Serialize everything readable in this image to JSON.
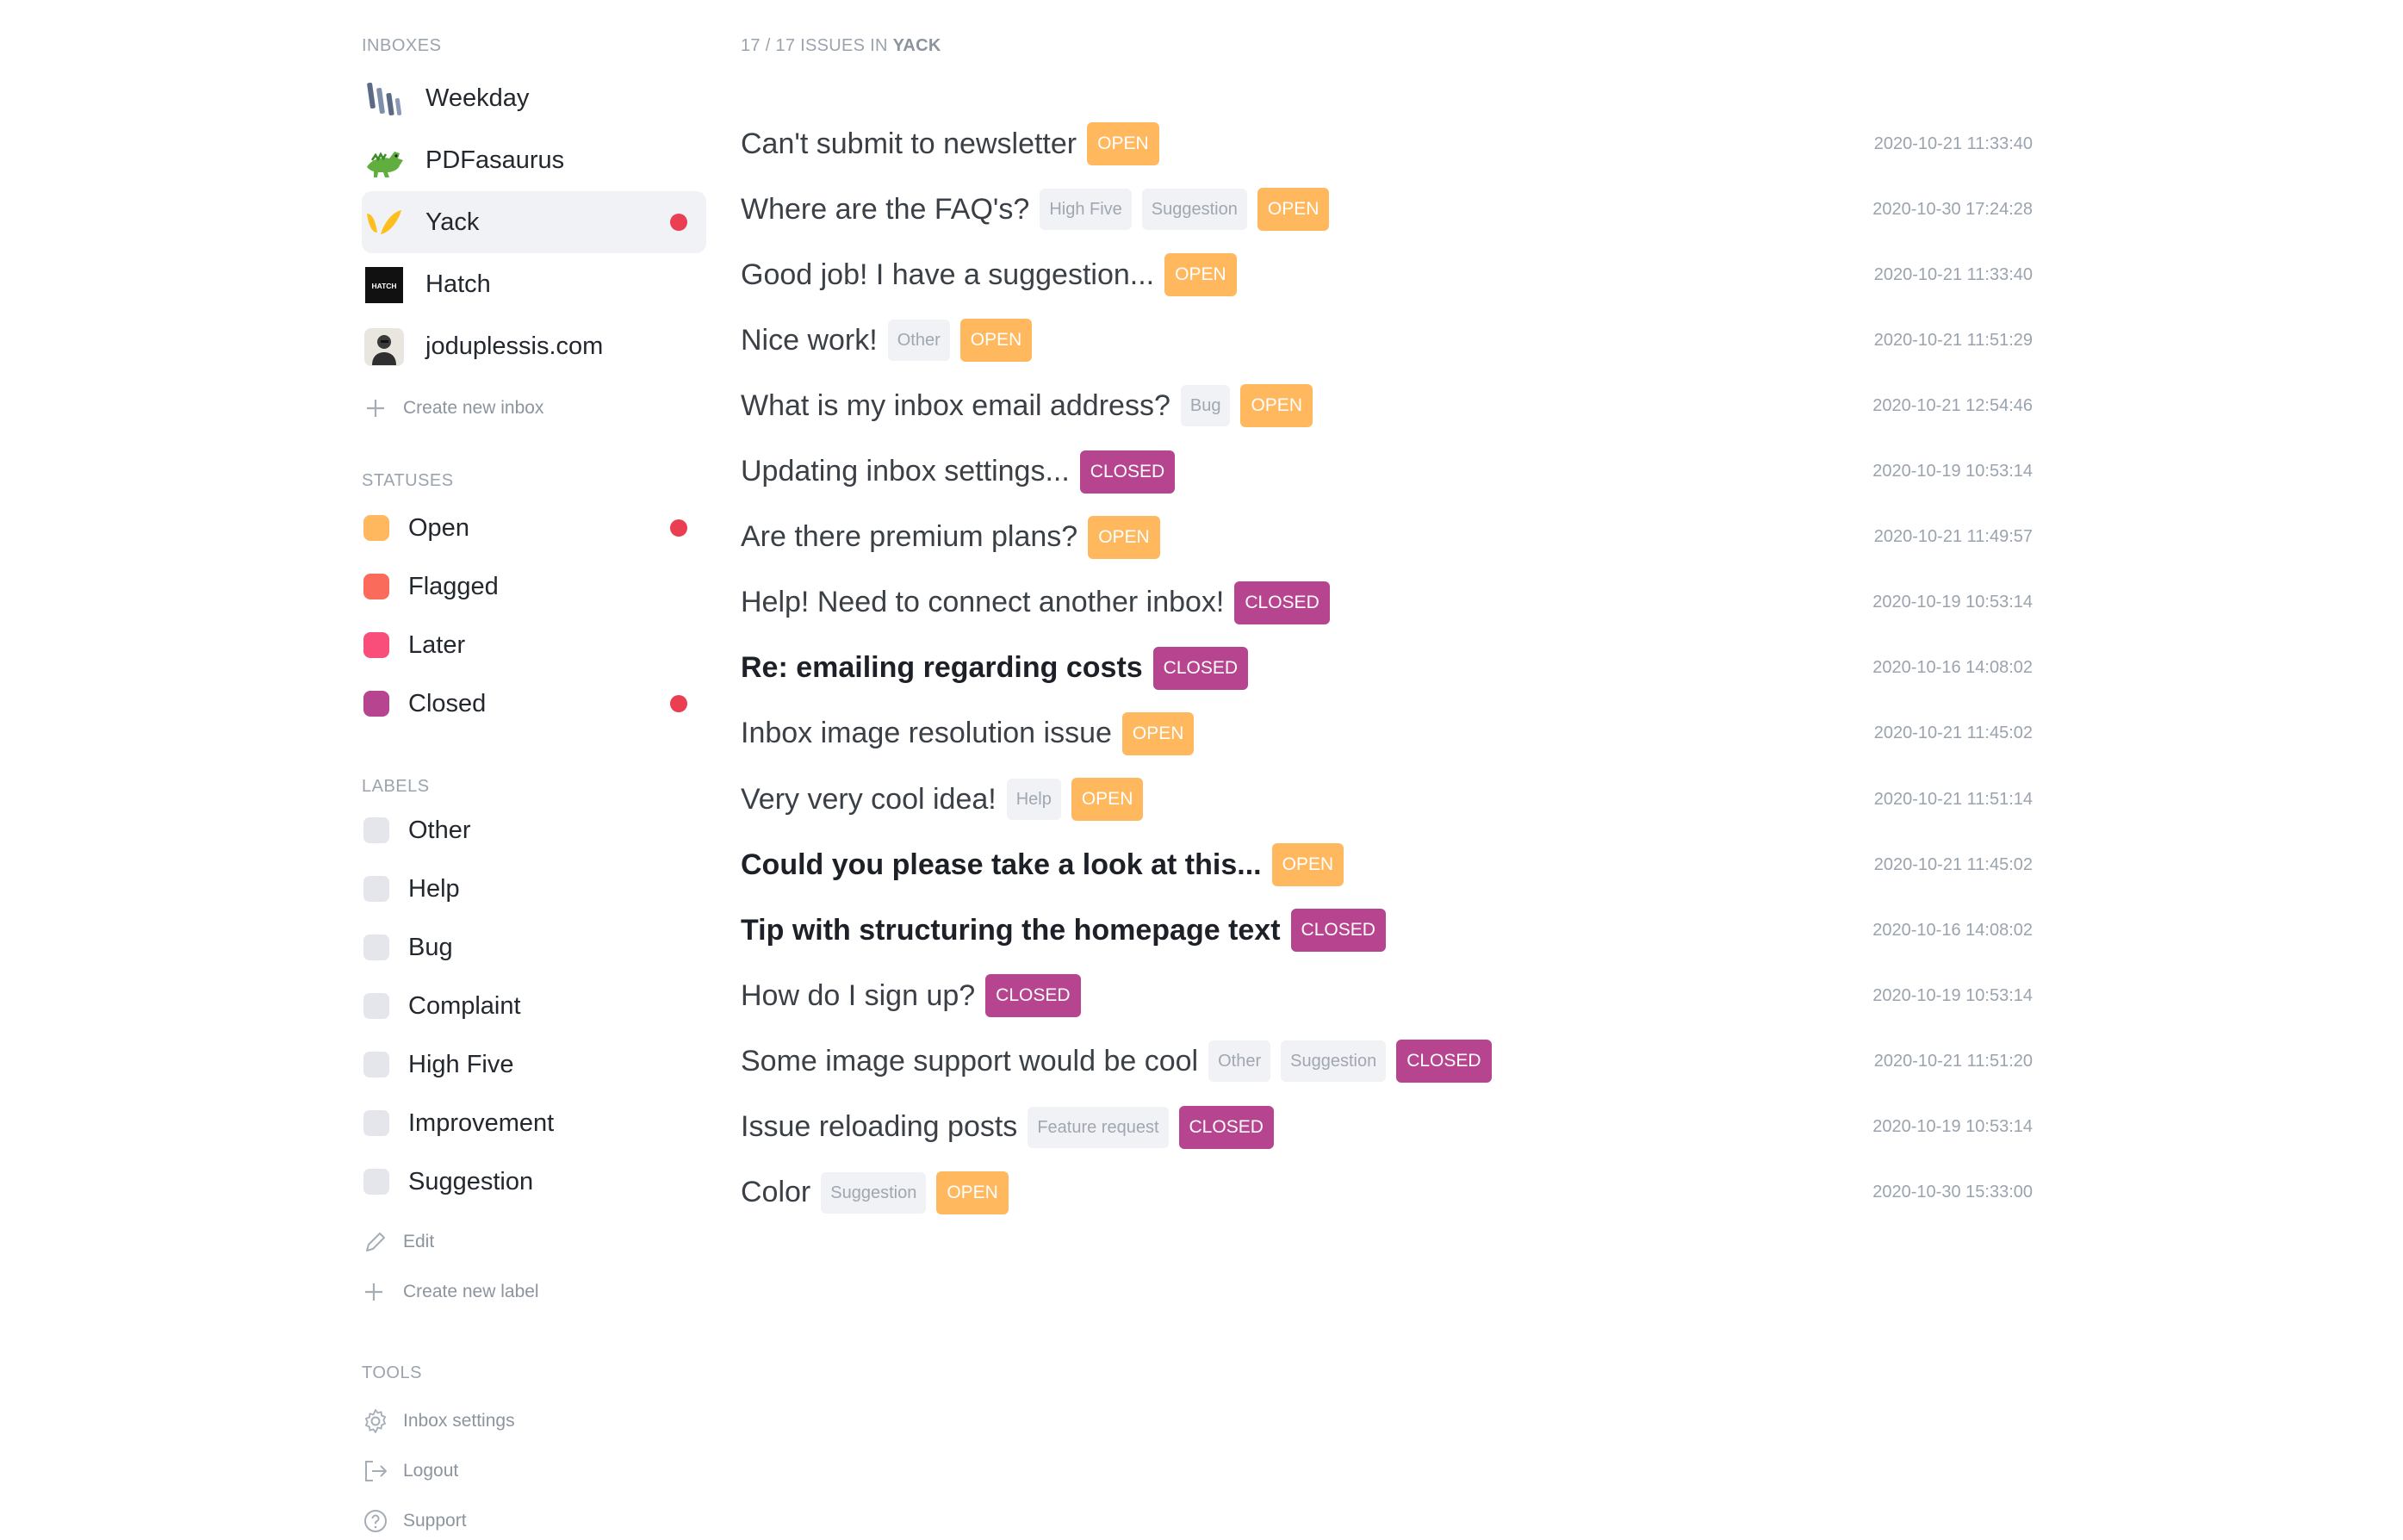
{
  "sidebar": {
    "inboxes_heading": "INBOXES",
    "inboxes": [
      {
        "name": "Weekday",
        "icon": "weekday-logo-icon",
        "active": false,
        "unread": false
      },
      {
        "name": "PDFasaurus",
        "icon": "pdfasaurus-dinosaur-icon",
        "active": false,
        "unread": false
      },
      {
        "name": "Yack",
        "icon": "yack-logo-icon",
        "active": true,
        "unread": true
      },
      {
        "name": "Hatch",
        "icon": "hatch-logo-icon",
        "logo_text": "HATCH",
        "active": false,
        "unread": false
      },
      {
        "name": "joduplessis.com",
        "icon": "avatar-icon",
        "active": false,
        "unread": false
      }
    ],
    "create_inbox": "Create new inbox",
    "statuses_heading": "STATUSES",
    "statuses": [
      {
        "name": "Open",
        "color": "#ffb85e",
        "unread": true
      },
      {
        "name": "Flagged",
        "color": "#fb6b5b",
        "unread": false
      },
      {
        "name": "Later",
        "color": "#f94e79",
        "unread": false
      },
      {
        "name": "Closed",
        "color": "#b6448f",
        "unread": true
      }
    ],
    "labels_heading": "LABELS",
    "labels": [
      "Other",
      "Help",
      "Bug",
      "Complaint",
      "High Five",
      "Improvement",
      "Suggestion"
    ],
    "edit": "Edit",
    "create_label": "Create new label",
    "tools_heading": "TOOLS",
    "tools": [
      {
        "name": "Inbox settings",
        "icon": "gear-icon"
      },
      {
        "name": "Logout",
        "icon": "logout-icon"
      },
      {
        "name": "Support",
        "icon": "help-circle-icon"
      }
    ]
  },
  "main": {
    "count_prefix": "17 / 17 ISSUES IN",
    "count_inbox": "YACK",
    "issues": [
      {
        "title": "Can't submit to newsletter",
        "tags": [],
        "status": "OPEN",
        "time": "2020-10-21 11:33:40",
        "unread": false
      },
      {
        "title": "Where are the FAQ's?",
        "tags": [
          "High Five",
          "Suggestion"
        ],
        "status": "OPEN",
        "time": "2020-10-30 17:24:28",
        "unread": false
      },
      {
        "title": "Good job! I have a suggestion...",
        "tags": [],
        "status": "OPEN",
        "time": "2020-10-21 11:33:40",
        "unread": false
      },
      {
        "title": "Nice work!",
        "tags": [
          "Other"
        ],
        "status": "OPEN",
        "time": "2020-10-21 11:51:29",
        "unread": false
      },
      {
        "title": "What is my inbox email address?",
        "tags": [
          "Bug"
        ],
        "status": "OPEN",
        "time": "2020-10-21 12:54:46",
        "unread": false
      },
      {
        "title": "Updating inbox settings...",
        "tags": [],
        "status": "CLOSED",
        "time": "2020-10-19 10:53:14",
        "unread": false
      },
      {
        "title": "Are there premium plans?",
        "tags": [],
        "status": "OPEN",
        "time": "2020-10-21 11:49:57",
        "unread": false
      },
      {
        "title": "Help! Need to connect another inbox!",
        "tags": [],
        "status": "CLOSED",
        "time": "2020-10-19 10:53:14",
        "unread": false
      },
      {
        "title": "Re: emailing regarding costs",
        "tags": [],
        "status": "CLOSED",
        "time": "2020-10-16 14:08:02",
        "unread": true
      },
      {
        "title": "Inbox image resolution issue",
        "tags": [],
        "status": "OPEN",
        "time": "2020-10-21 11:45:02",
        "unread": false
      },
      {
        "title": "Very very cool idea!",
        "tags": [
          "Help"
        ],
        "status": "OPEN",
        "time": "2020-10-21 11:51:14",
        "unread": false
      },
      {
        "title": "Could you please take a look at this...",
        "tags": [],
        "status": "OPEN",
        "time": "2020-10-21 11:45:02",
        "unread": true
      },
      {
        "title": "Tip with structuring the homepage text",
        "tags": [],
        "status": "CLOSED",
        "time": "2020-10-16 14:08:02",
        "unread": true
      },
      {
        "title": "How do I sign up?",
        "tags": [],
        "status": "CLOSED",
        "time": "2020-10-19 10:53:14",
        "unread": false
      },
      {
        "title": "Some image support would be cool",
        "tags": [
          "Other",
          "Suggestion"
        ],
        "status": "CLOSED",
        "time": "2020-10-21 11:51:20",
        "unread": false
      },
      {
        "title": "Issue reloading posts",
        "tags": [
          "Feature request"
        ],
        "status": "CLOSED",
        "time": "2020-10-19 10:53:14",
        "unread": false
      },
      {
        "title": "Color",
        "tags": [
          "Suggestion"
        ],
        "status": "OPEN",
        "time": "2020-10-30 15:33:00",
        "unread": false
      }
    ]
  },
  "colors": {
    "open": "#ffb85e",
    "closed": "#b6448f",
    "unread_dot": "#ea3f52",
    "active_bg": "#f1f2f5"
  }
}
